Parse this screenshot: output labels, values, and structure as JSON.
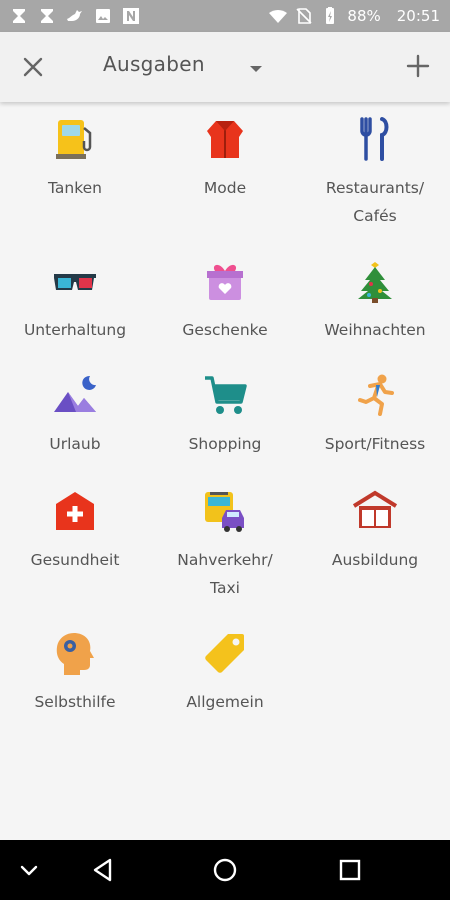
{
  "status_bar": {
    "battery": "88%",
    "time": "20:51"
  },
  "app_bar": {
    "title": "Ausgaben"
  },
  "categories": [
    {
      "label": "Tanken",
      "icon": "fuel-pump-icon"
    },
    {
      "label": "Mode",
      "icon": "jacket-icon"
    },
    {
      "label": "Restaurants/\nCafés",
      "icon": "fork-knife-icon"
    },
    {
      "label": "Unterhaltung",
      "icon": "3d-glasses-icon"
    },
    {
      "label": "Geschenke",
      "icon": "gift-icon"
    },
    {
      "label": "Weihnachten",
      "icon": "christmas-tree-icon"
    },
    {
      "label": "Urlaub",
      "icon": "mountains-moon-icon"
    },
    {
      "label": "Shopping",
      "icon": "shopping-cart-icon"
    },
    {
      "label": "Sport/Fitness",
      "icon": "runner-icon"
    },
    {
      "label": "Gesundheit",
      "icon": "medical-bag-icon"
    },
    {
      "label": "Nahverkehr/\nTaxi",
      "icon": "bus-taxi-icon"
    },
    {
      "label": "Ausbildung",
      "icon": "book-house-icon"
    },
    {
      "label": "Selbsthilfe",
      "icon": "head-gear-icon"
    },
    {
      "label": "Allgemein",
      "icon": "tag-icon"
    }
  ],
  "colors": {
    "status_bar": "#a7a7a7",
    "app_bar": "#f1f1f1",
    "background": "#f5f5f5",
    "nav_bar": "#000000"
  }
}
